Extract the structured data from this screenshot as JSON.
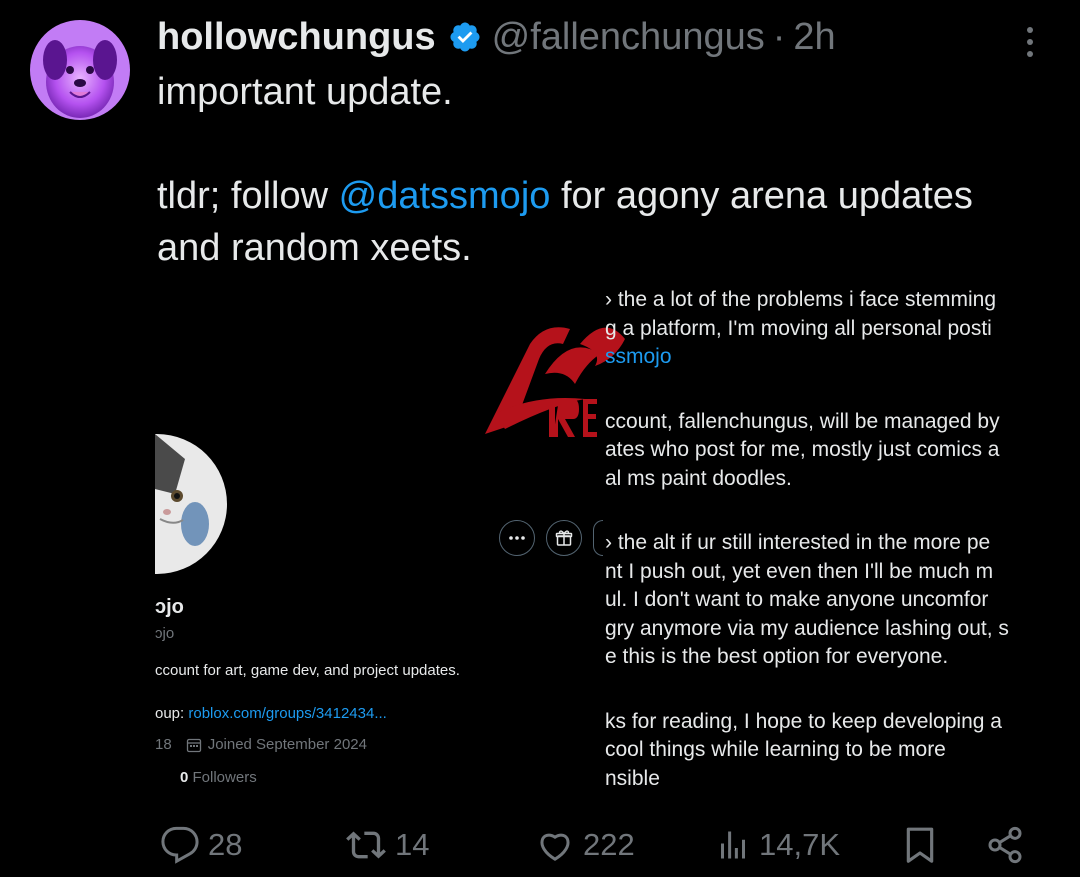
{
  "tweet": {
    "display_name": "hollowchungus",
    "handle": "@fallenchungus",
    "separator": "·",
    "time": "2h",
    "line1": "important update.",
    "line2_pre": "tldr; follow ",
    "line2_mention": "@datssmojo",
    "line2_post": " for agony arena updates",
    "line3": "and random xeets."
  },
  "embed": {
    "profile": {
      "name": "ɔjo",
      "handle": "ɔjo",
      "bio": "ccount for art, game dev, and project updates.",
      "link_label": "oup: ",
      "link": "roblox.com/groups/3412434...",
      "meta_partial": "18",
      "joined": "Joined September 2024",
      "followers_count": "0",
      "followers_label": "Followers"
    },
    "note_lines": [
      "› the a lot of the problems i face stemming",
      "g a platform, I'm moving all personal posti",
      "ssmojo",
      "",
      "ccount, fallenchungus, will be managed by",
      "ates who post for me, mostly just comics a",
      "al ms paint doodles.",
      "",
      "› the alt if ur still interested in the more pe",
      "nt I push out, yet even then I'll be much m",
      "ul. I don't want to make anyone uncomfor",
      "gry anymore via my audience lashing out, s",
      "e this is the best option for everyone.",
      "",
      "ks for reading, I hope to keep developing a",
      " cool things while learning to be more",
      "nsible"
    ]
  },
  "actions": {
    "replies": "28",
    "reposts": "14",
    "likes": "222",
    "views": "14,7K"
  },
  "colors": {
    "background": "#000000",
    "text": "#e7e9ea",
    "muted": "#71767b",
    "accent": "#1d9bf0",
    "logo_red": "#b5121b"
  }
}
